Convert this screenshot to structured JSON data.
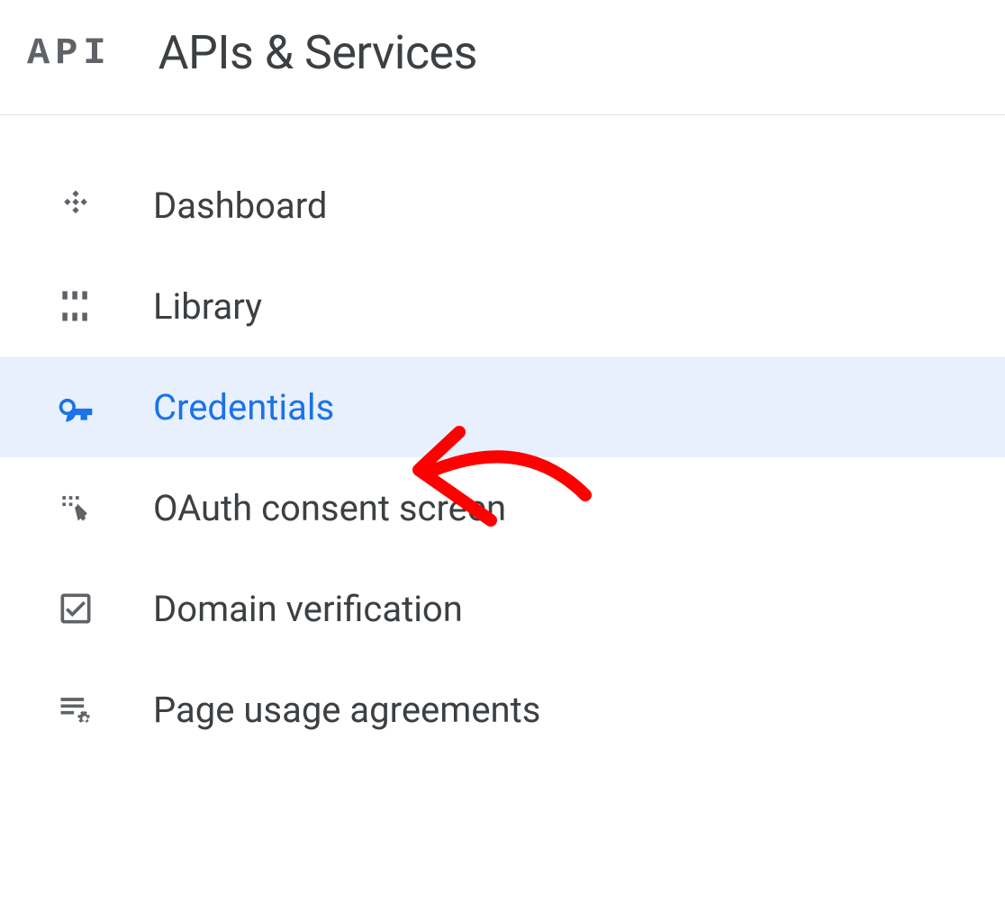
{
  "header": {
    "badge": "API",
    "title": "APIs & Services"
  },
  "nav": {
    "items": [
      {
        "label": "Dashboard",
        "icon": "dashboard-diamond-icon",
        "selected": false
      },
      {
        "label": "Library",
        "icon": "library-icon",
        "selected": false
      },
      {
        "label": "Credentials",
        "icon": "key-icon",
        "selected": true
      },
      {
        "label": "OAuth consent screen",
        "icon": "oauth-consent-icon",
        "selected": false
      },
      {
        "label": "Domain verification",
        "icon": "checkbox-icon",
        "selected": false
      },
      {
        "label": "Page usage agreements",
        "icon": "page-gear-icon",
        "selected": false
      }
    ]
  },
  "annotation": {
    "color": "#ff0000"
  }
}
